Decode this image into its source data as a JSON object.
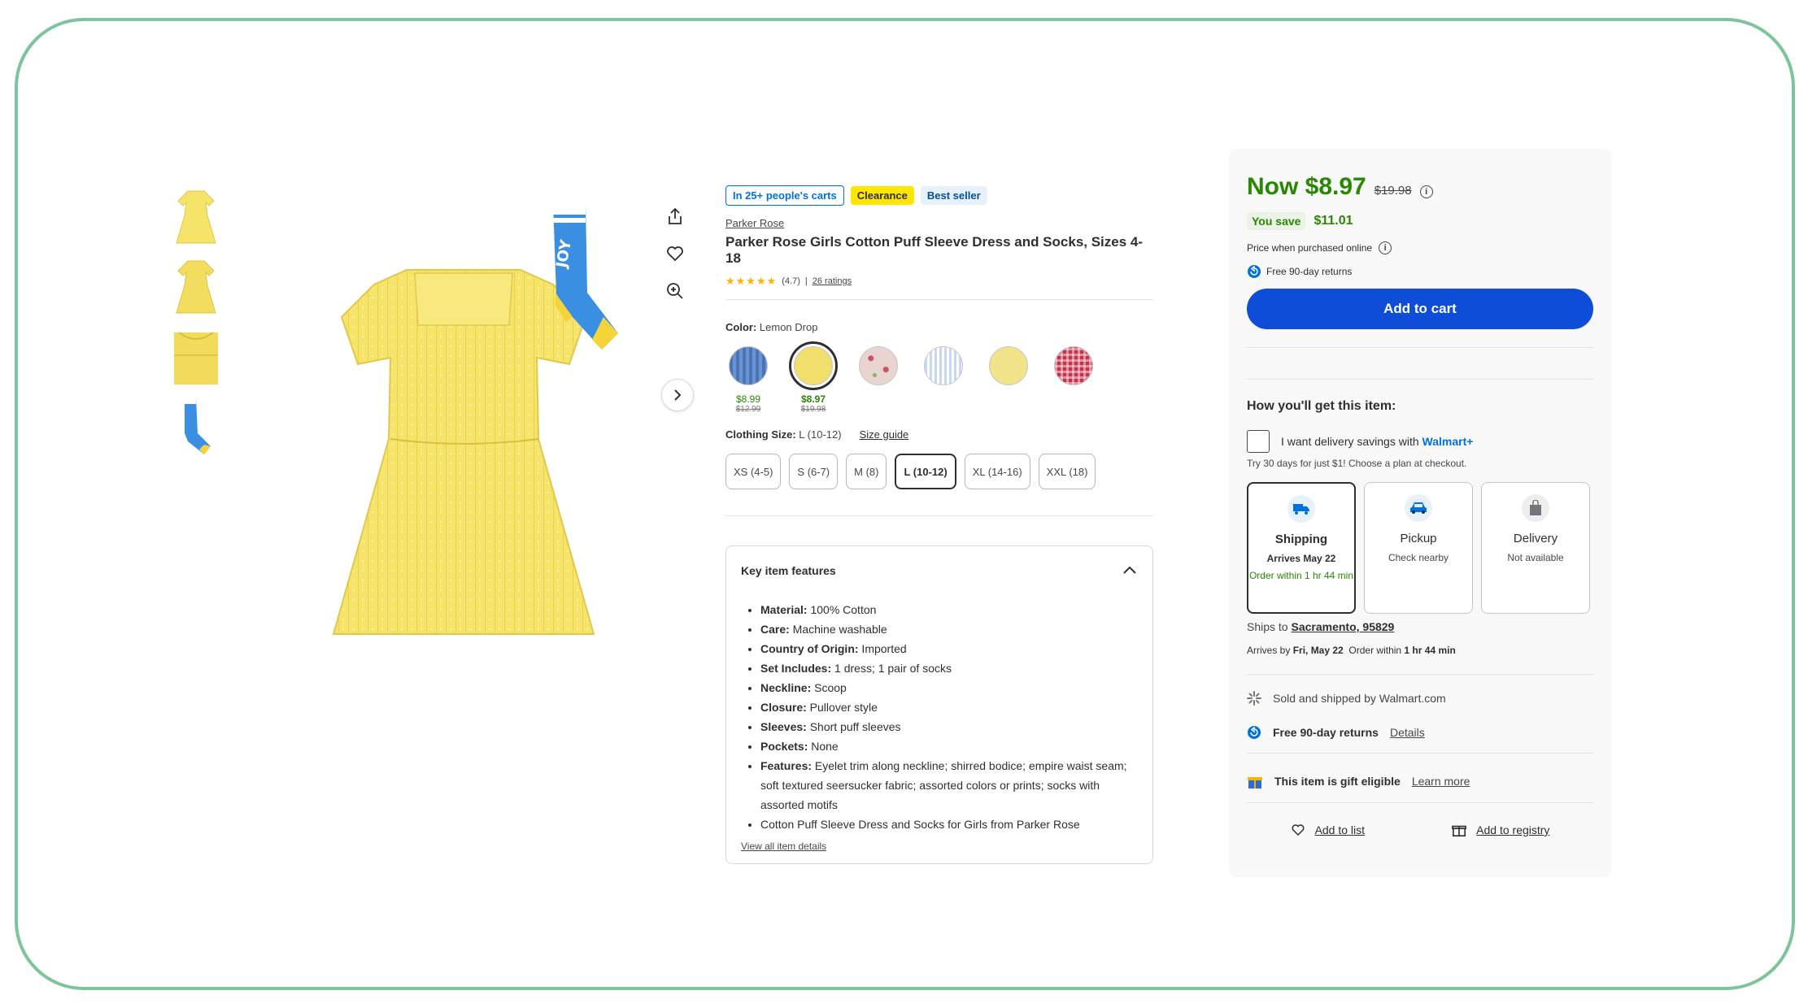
{
  "thumbnails": [
    {
      "name": "dress-front"
    },
    {
      "name": "dress-alt"
    },
    {
      "name": "dress-detail"
    },
    {
      "name": "socks"
    }
  ],
  "badges": {
    "carts": "In 25+ people's carts",
    "clearance": "Clearance",
    "bestseller": "Best seller"
  },
  "product": {
    "brand": "Parker Rose",
    "title": "Parker Rose Girls Cotton Puff Sleeve Dress and Socks, Sizes 4-18",
    "stars": "★★★★★",
    "rating": "(4.7)",
    "separator": "|",
    "ratings_link": "26 ratings",
    "rating_value": 4.7
  },
  "color": {
    "label": "Color:",
    "value": "Lemon Drop",
    "swatches": [
      {
        "color": "#4a74b8",
        "pattern": "denim",
        "now": "$8.99",
        "was": "$12.99"
      },
      {
        "color": "#f2df6b",
        "pattern": "solid",
        "now": "$8.97",
        "was": "$19.98",
        "selected": true
      },
      {
        "color": "#e9d4d0",
        "pattern": "floral",
        "now": "",
        "was": ""
      },
      {
        "color": "#c9d8f2",
        "pattern": "stripe",
        "now": "",
        "was": ""
      },
      {
        "color": "#f1e38a",
        "pattern": "solid",
        "now": "",
        "was": ""
      },
      {
        "color": "#c7324b",
        "pattern": "gingham",
        "now": "",
        "was": ""
      }
    ]
  },
  "size": {
    "label": "Clothing Size:",
    "value": "L (10-12)",
    "guide": "Size guide",
    "options": [
      "XS (4-5)",
      "S (6-7)",
      "M (8)",
      "L (10-12)",
      "XL (14-16)",
      "XXL (18)"
    ],
    "selected_index": 3
  },
  "features": {
    "heading": "Key item features",
    "items": [
      {
        "label": "Material:",
        "text": " 100% Cotton"
      },
      {
        "label": "Care:",
        "text": " Machine washable"
      },
      {
        "label": "Country of Origin:",
        "text": " Imported"
      },
      {
        "label": "Set Includes:",
        "text": " 1 dress; 1 pair of socks"
      },
      {
        "label": "Neckline:",
        "text": " Scoop"
      },
      {
        "label": "Closure:",
        "text": " Pullover style"
      },
      {
        "label": "Sleeves:",
        "text": " Short puff sleeves"
      },
      {
        "label": "Pockets:",
        "text": " None"
      },
      {
        "label": "Features:",
        "text": " Eyelet trim along neckline; shirred bodice; empire waist seam; soft textured seersucker fabric; assorted colors or prints; socks with assorted motifs"
      },
      {
        "label": "",
        "text": "Cotton Puff Sleeve Dress and Socks for Girls from Parker Rose"
      }
    ],
    "view_all": "View all item details"
  },
  "buybox": {
    "now_price": "Now $8.97",
    "was_price": "$19.98",
    "info_glyph": "i",
    "save_label": "You save",
    "save_amount": "$11.01",
    "online_note": "Price when purchased online",
    "returns": "Free 90-day returns",
    "add_to_cart": "Add to cart",
    "how_heading": "How you'll get this item:",
    "wplus_text": "I want delivery savings with",
    "wplus_brand": "Walmart+",
    "wplus_sub": "Try 30 days for just $1! Choose a plan at checkout.",
    "fulfillment": [
      {
        "name": "Shipping",
        "sub": "Arrives May 22",
        "order": "Order within 1 hr 44 min",
        "selected": true
      },
      {
        "name": "Pickup",
        "sub": "Check nearby",
        "order": ""
      },
      {
        "name": "Delivery",
        "sub": "Not available",
        "order": ""
      }
    ],
    "ships_to_label": "Ships to",
    "ships_to_location": "Sacramento, 95829",
    "arrives_prefix": "Arrives by",
    "arrives_date": "Fri, May 22",
    "arrives_mid": "Order within",
    "arrives_time": "1 hr 44 min",
    "sold_by": "Sold and shipped by Walmart.com",
    "free_returns": "Free 90-day returns",
    "details_link": "Details",
    "gift": "This item is gift eligible",
    "learn_more": "Learn more",
    "add_to_list": "Add to list",
    "add_to_registry": "Add to registry"
  },
  "colors": {
    "green": "#2a8703",
    "blue_cta": "#0e4dd8",
    "walmart_blue": "#0071dc",
    "frame_green": "#7cc49b",
    "dress_yellow": "#f5e36a"
  }
}
